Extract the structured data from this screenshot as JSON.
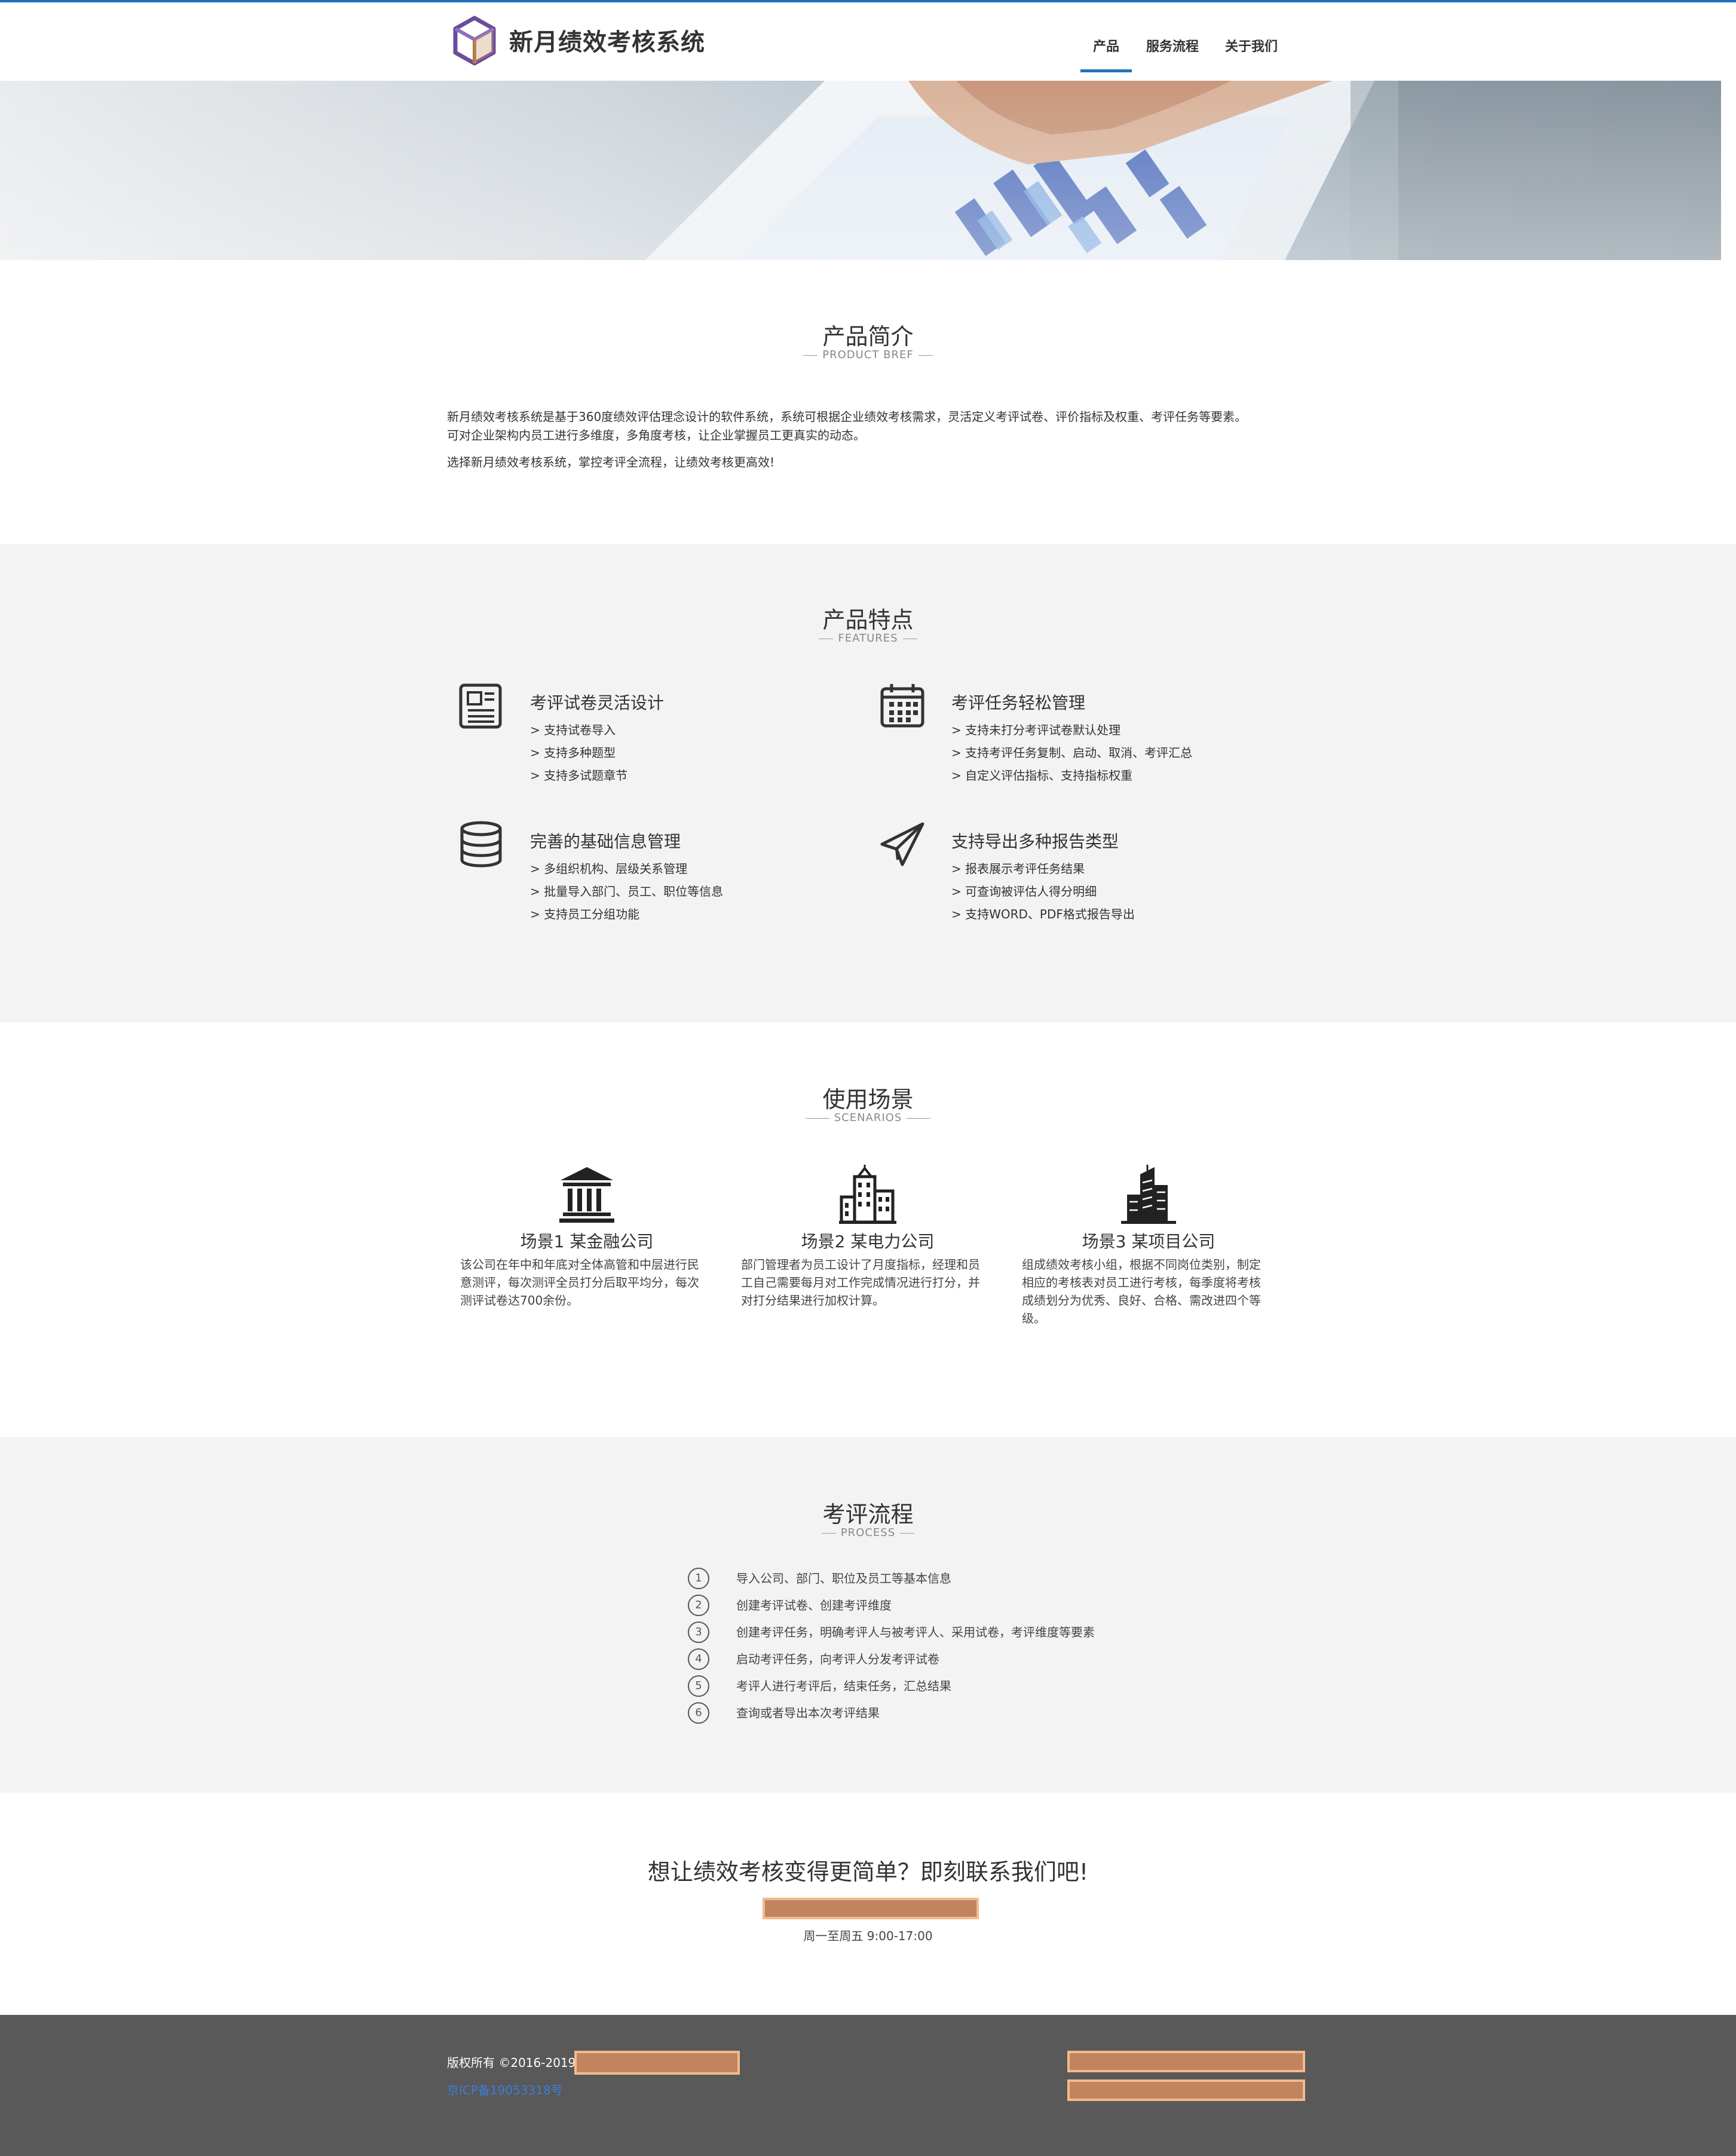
{
  "header": {
    "brand": "新月绩效考核系统",
    "nav": [
      "产品",
      "服务流程",
      "关于我们"
    ]
  },
  "intro": {
    "title": "产品简介",
    "subtitle": "PRODUCT BREF",
    "para1_line1": "新月绩效考核系统是基于360度绩效评估理念设计的软件系统，系统可根据企业绩效考核需求，灵活定义考评试卷、评价指标及权重、考评任务等要素。",
    "para1_line2": "可对企业架构内员工进行多维度，多角度考核，让企业掌握员工更真实的动态。",
    "para2": "选择新月绩效考核系统，掌控考评全流程，让绩效考核更高效!"
  },
  "features": {
    "title": "产品特点",
    "subtitle": "FEATURES",
    "items": [
      {
        "title": "考评试卷灵活设计",
        "icon": "newspaper-icon",
        "points": [
          "> 支持试卷导入",
          "> 支持多种题型",
          "> 支持多试题章节"
        ]
      },
      {
        "title": "考评任务轻松管理",
        "icon": "calendar-icon",
        "points": [
          "> 支持未打分考评试卷默认处理",
          "> 支持考评任务复制、启动、取消、考评汇总",
          "> 自定义评估指标、支持指标权重"
        ]
      },
      {
        "title": "完善的基础信息管理",
        "icon": "database-icon",
        "points": [
          "> 多组织机构、层级关系管理",
          "> 批量导入部门、员工、职位等信息",
          "> 支持员工分组功能"
        ]
      },
      {
        "title": "支持导出多种报告类型",
        "icon": "paper-plane-icon",
        "points": [
          "> 报表展示考评任务结果",
          "> 可查询被评估人得分明细",
          "> 支持WORD、PDF格式报告导出"
        ]
      }
    ]
  },
  "scenarios": {
    "title": "使用场景",
    "subtitle": "SCENARIOS",
    "items": [
      {
        "title": "场景1 某金融公司",
        "icon": "bank-icon",
        "lines": [
          "该公司在年中和年底对全体高管和中层进行民",
          "意测评，每次测评全员打分后取平均分，每次",
          "测评试卷达700余份。"
        ]
      },
      {
        "title": "场景2 某电力公司",
        "icon": "city-buildings-icon",
        "lines": [
          "部门管理者为员工设计了月度指标，经理和员",
          "工自己需要每月对工作完成情况进行打分，并",
          "对打分结果进行加权计算。"
        ]
      },
      {
        "title": "场景3 某项目公司",
        "icon": "skyscraper-icon",
        "lines": [
          "组成绩效考核小组，根据不同岗位类别，制定",
          "相应的考核表对员工进行考核，每季度将考核",
          "成绩划分为优秀、良好、合格、需改进四个等",
          "级。"
        ]
      }
    ]
  },
  "process": {
    "title": "考评流程",
    "subtitle": "PROCESS",
    "steps": [
      {
        "num": "1",
        "text": "导入公司、部门、职位及员工等基本信息"
      },
      {
        "num": "2",
        "text": "创建考评试卷、创建考评维度"
      },
      {
        "num": "3",
        "text": "创建考评任务，明确考评人与被考评人、采用试卷，考评维度等要素"
      },
      {
        "num": "4",
        "text": "启动考评任务，向考评人分发考评试卷"
      },
      {
        "num": "5",
        "text": "考评人进行考评后，结束任务，汇总结果"
      },
      {
        "num": "6",
        "text": "查询或者导出本次考评结果"
      }
    ]
  },
  "contact": {
    "headline": "想让绩效考核变得更简单？即刻联系我们吧!",
    "hours": "周一至周五 9:00-17:00"
  },
  "footer": {
    "copyright": "版权所有 ©2016-2019",
    "icp": "京ICP备19053318号"
  },
  "colors": {
    "accent": "#1e73be",
    "section_gray": "#f3f3f3",
    "footer_bg": "#595959",
    "redaction": "#c1845f"
  }
}
